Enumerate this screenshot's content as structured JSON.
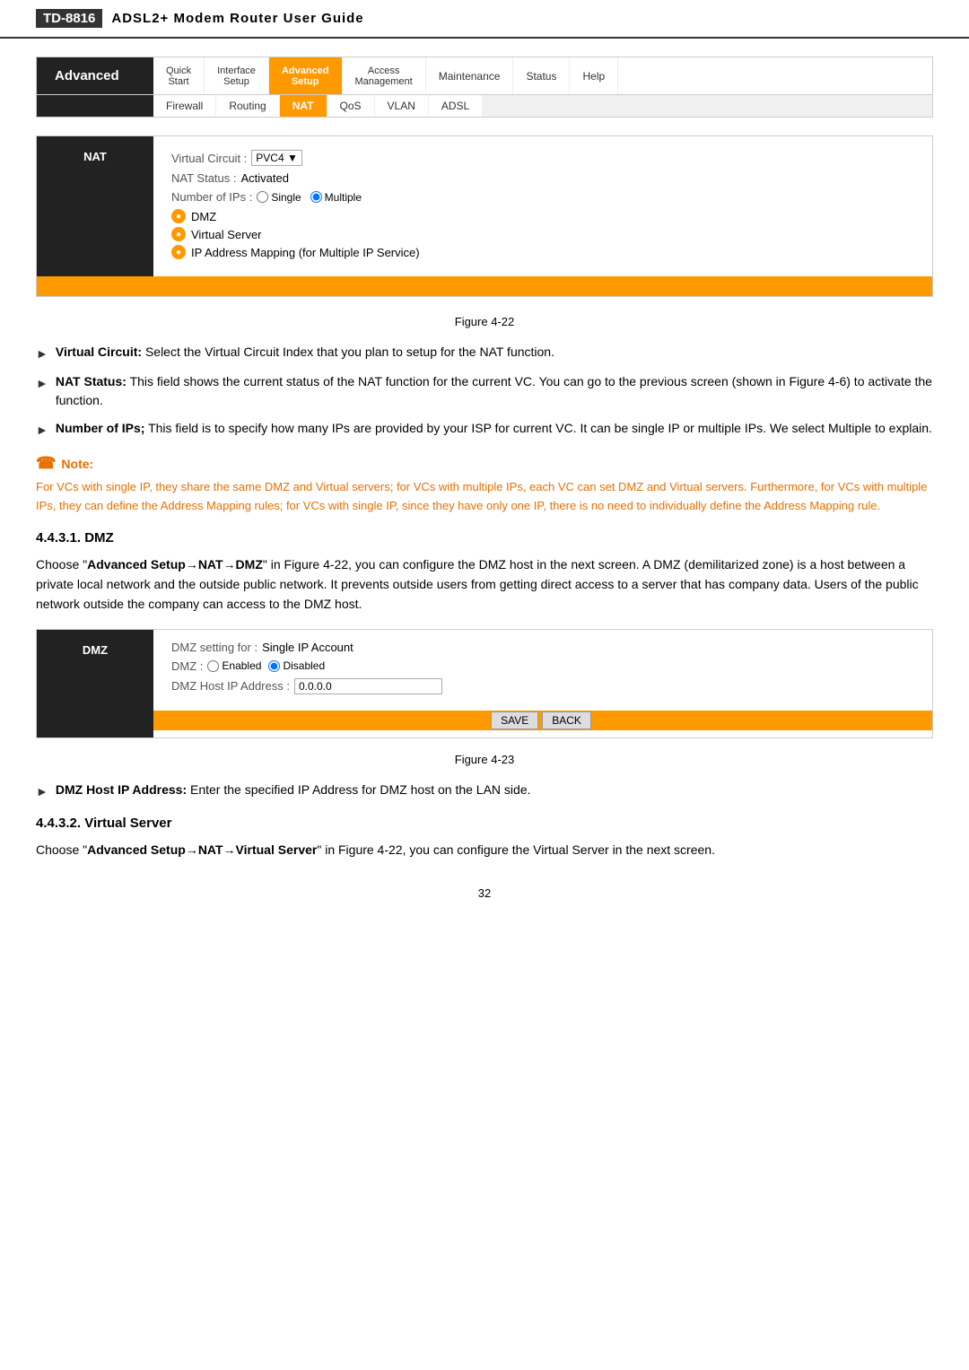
{
  "header": {
    "model": "TD-8816",
    "title": "ADSL2+  Modem  Router  User  Guide"
  },
  "nav": {
    "brand": "Advanced",
    "items": [
      {
        "label_top": "Quick",
        "label_bottom": "Start",
        "active": false
      },
      {
        "label_top": "Interface",
        "label_bottom": "Setup",
        "active": false
      },
      {
        "label_top": "Advanced",
        "label_bottom": "Setup",
        "active": true
      },
      {
        "label_top": "Access",
        "label_bottom": "Management",
        "active": false
      },
      {
        "label": "Maintenance",
        "active": false
      },
      {
        "label": "Status",
        "active": false
      },
      {
        "label": "Help",
        "active": false
      }
    ],
    "subnav": [
      {
        "label": "Firewall",
        "active": false
      },
      {
        "label": "Routing",
        "active": false
      },
      {
        "label": "NAT",
        "active": true
      },
      {
        "label": "QoS",
        "active": false
      },
      {
        "label": "VLAN",
        "active": false
      },
      {
        "label": "ADSL",
        "active": false
      }
    ]
  },
  "nat_panel": {
    "sidebar_label": "NAT",
    "virtual_circuit_label": "Virtual Circuit :",
    "virtual_circuit_value": "PVC4",
    "nat_status_label": "NAT Status :",
    "nat_status_value": "Activated",
    "number_of_ips_label": "Number of IPs :",
    "single_label": "Single",
    "multiple_label": "Multiple",
    "menu_items": [
      {
        "label": "DMZ"
      },
      {
        "label": "Virtual Server"
      },
      {
        "label": "IP Address Mapping (for Multiple IP Service)"
      }
    ]
  },
  "figure22_caption": "Figure 4-22",
  "bullet_items": [
    {
      "term": "Virtual Circuit:",
      "text": " Select the Virtual Circuit Index that you plan to setup for the NAT function."
    },
    {
      "term": "NAT Status:",
      "text": " This field shows the current status of the NAT function for the current VC. You can go to the previous screen (shown in Figure 4-6) to activate the function."
    },
    {
      "term": "Number of IPs;",
      "text": " This field is to specify how many IPs are provided by your ISP for current VC. It can be single IP or multiple IPs. We select Multiple to explain."
    }
  ],
  "note": {
    "label": "Note:",
    "text": "For VCs with single IP, they share the same DMZ and Virtual servers; for VCs with multiple IPs, each VC can set DMZ and Virtual servers. Furthermore, for VCs with multiple IPs, they can define the Address Mapping rules; for VCs with single IP, since they have only one IP, there is no need to individually define the Address Mapping rule."
  },
  "dmz_section": {
    "heading": "4.4.3.1.  DMZ",
    "intro": "Choose \"Advanced Setup→NAT→DMZ\" in Figure 4-22, you can configure the DMZ host in the next screen. A DMZ (demilitarized zone) is a host between a private local network and the outside public network. It prevents outside users from getting direct access to a server that has company data. Users of the public network outside the company can access to the DMZ host.",
    "panel": {
      "sidebar_label": "DMZ",
      "setting_for_label": "DMZ setting for :",
      "setting_for_value": "Single IP Account",
      "dmz_label": "DMZ :",
      "enabled_label": "Enabled",
      "disabled_label": "Disabled",
      "host_ip_label": "DMZ Host IP Address :",
      "host_ip_value": "0.0.0.0",
      "save_btn": "SAVE",
      "back_btn": "BACK"
    }
  },
  "figure23_caption": "Figure 4-23",
  "dmz_host_bullet": {
    "term": "DMZ Host IP Address:",
    "text": " Enter the specified IP Address for DMZ host on the LAN side."
  },
  "virtual_server_section": {
    "heading": "4.4.3.2.  Virtual Server",
    "text": "Choose \"Advanced Setup→NAT→Virtual Server\" in Figure 4-22, you can configure the Virtual Server in the next screen."
  },
  "page_number": "32"
}
